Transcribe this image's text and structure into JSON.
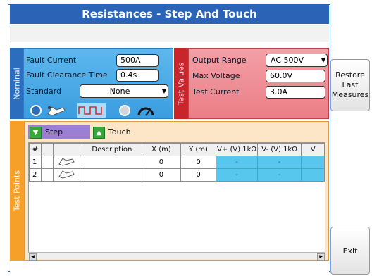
{
  "window": {
    "title": "Resistances - Step And Touch"
  },
  "nominal": {
    "tab_label": "Nominal",
    "fault_current_label": "Fault Current",
    "fault_current_value": "500A",
    "fault_clearance_label": "Fault Clearance Time",
    "fault_clearance_value": "0.4s",
    "standard_label": "Standard",
    "standard_value": "None",
    "icons": [
      "body-model-icon",
      "step-touch-icon",
      "waveform-icon",
      "circle-icon",
      "gauge-icon"
    ]
  },
  "test_values": {
    "tab_label": "Test Values",
    "output_range_label": "Output Range",
    "output_range_value": "AC 500V",
    "max_voltage_label": "Max Voltage",
    "max_voltage_value": "60.0V",
    "test_current_label": "Test Current",
    "test_current_value": "3.0A"
  },
  "buttons": {
    "restore": "Restore\nLast\nMeasures",
    "exit": "Exit"
  },
  "test_points": {
    "tab_label": "Test Points",
    "tabs": [
      {
        "label": "Step"
      },
      {
        "label": "Touch"
      }
    ],
    "columns": [
      "#",
      "",
      "Description",
      "X (m)",
      "Y (m)",
      "V+ (V) 1kΩ",
      "V- (V) 1kΩ",
      "V"
    ],
    "rows": [
      {
        "num": "1",
        "description": "",
        "x": "0",
        "y": "0",
        "vplus": "-",
        "vminus": "-"
      },
      {
        "num": "2",
        "description": "",
        "x": "0",
        "y": "0",
        "vplus": "-",
        "vminus": "-"
      }
    ]
  },
  "colors": {
    "title_bar": "#2b63b6",
    "nominal": "#3a9de0",
    "test_values": "#c8262b",
    "test_points": "#f6a02a",
    "measure_cell": "#58c7ee",
    "step_tab": "#9a7fd2"
  }
}
